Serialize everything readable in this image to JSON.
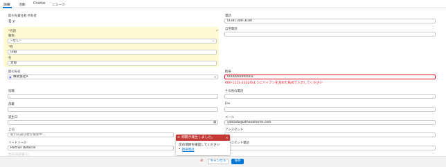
{
  "tabs": [
    "詳細",
    "活動",
    "Chatter",
    "ニュース"
  ],
  "left": {
    "owner_label": "取引先責任者 所有者",
    "owner_value": "名 y",
    "name_label": "名前",
    "salutation_label": "敬称",
    "salutation_value": "--なし--",
    "last_name_label": "姓",
    "last_name_value": "山田",
    "first_name_label": "名",
    "first_name_value": "太郎",
    "account_label": "取引先名",
    "account_value": "株式会社A",
    "title_label": "役職",
    "department_label": "部署",
    "birthdate_label": "誕生日",
    "reports_to_label": "上司",
    "reports_to_placeholder": "取引先責任者を検索中...",
    "lead_source_label": "リードソース",
    "lead_source_value": "Partner Referral",
    "bottom_label": "住所(郵便番号)"
  },
  "right": {
    "phone_label": "電話",
    "phone_value": "(434) 300-3100",
    "home_phone_label": "自宅電話",
    "mobile_label": "携帯",
    "mobile_value": "00000000000lia",
    "mobile_error": "000-1111-2222のようにハイフンを含めた形式で入力してください",
    "other_phone_label": "その他の電話",
    "fax_label": "Fax",
    "email_label": "メール",
    "email_value": "yamada@athenahome.com",
    "assistant_label": "アシスタント",
    "assistant_phone_label": "アシスタント電話"
  },
  "popover": {
    "title": "問題が発生しました。",
    "body": "次の項目を確認してください",
    "link": "携帯電話"
  },
  "footer": {
    "cancel": "キャンセル",
    "save": "保存"
  },
  "colors": {
    "accent": "#0176d3",
    "error": "#ea001e",
    "required_highlight": "#fefad4",
    "error_header": "#c23934"
  }
}
